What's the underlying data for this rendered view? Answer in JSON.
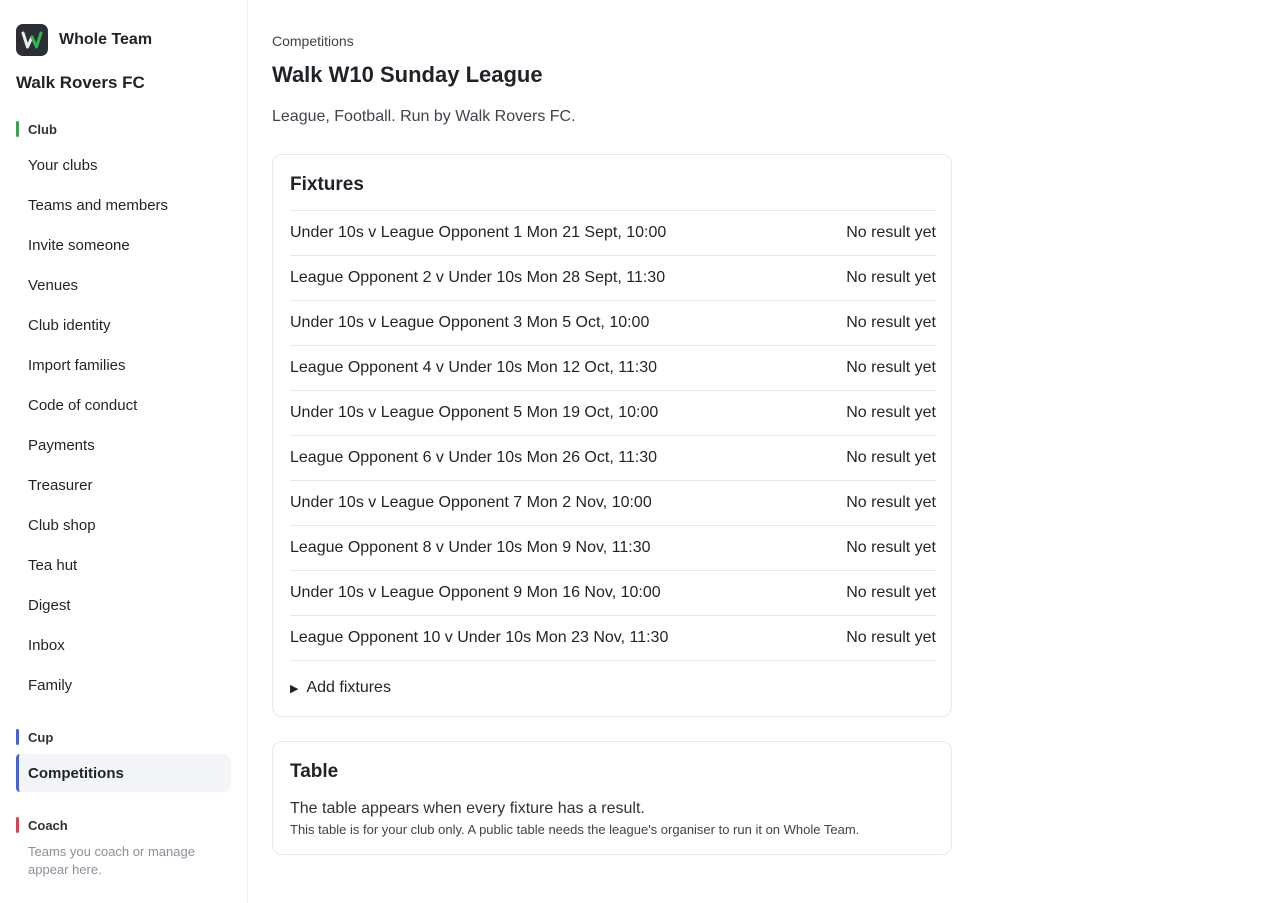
{
  "brand": {
    "name": "Whole Team",
    "logo_icon": "whole-team-w-logo",
    "logo_bg": "#2b2f33"
  },
  "sidebar": {
    "club_name": "Walk Rovers FC",
    "sections": {
      "club": {
        "label": "Club",
        "color": "#2fa84f"
      },
      "cup": {
        "label": "Cup",
        "color": "#3f63e0"
      },
      "coach": {
        "label": "Coach",
        "color": "#e0404a"
      }
    },
    "club_items": [
      "Your clubs",
      "Teams and members",
      "Invite someone",
      "Venues",
      "Club identity",
      "Import families",
      "Code of conduct",
      "Payments",
      "Treasurer",
      "Club shop",
      "Tea hut",
      "Digest",
      "Inbox",
      "Family"
    ],
    "cup_items": [
      "Competitions"
    ],
    "coach_note": "Teams you coach or manage appear here."
  },
  "main": {
    "breadcrumb": "Competitions",
    "title": "Walk W10 Sunday League",
    "subtitle": "League, Football. Run by Walk Rovers FC.",
    "fixtures": {
      "heading": "Fixtures",
      "rows": [
        {
          "match": "Under 10s v League Opponent 1 Mon 21 Sept, 10:00",
          "status": "No result yet"
        },
        {
          "match": "League Opponent 2 v Under 10s Mon 28 Sept, 11:30",
          "status": "No result yet"
        },
        {
          "match": "Under 10s v League Opponent 3 Mon 5 Oct, 10:00",
          "status": "No result yet"
        },
        {
          "match": "League Opponent 4 v Under 10s Mon 12 Oct, 11:30",
          "status": "No result yet"
        },
        {
          "match": "Under 10s v League Opponent 5 Mon 19 Oct, 10:00",
          "status": "No result yet"
        },
        {
          "match": "League Opponent 6 v Under 10s Mon 26 Oct, 11:30",
          "status": "No result yet"
        },
        {
          "match": "Under 10s v League Opponent 7 Mon 2 Nov, 10:00",
          "status": "No result yet"
        },
        {
          "match": "League Opponent 8 v Under 10s Mon 9 Nov, 11:30",
          "status": "No result yet"
        },
        {
          "match": "Under 10s v League Opponent 9 Mon 16 Nov, 10:00",
          "status": "No result yet"
        },
        {
          "match": "League Opponent 10 v Under 10s Mon 23 Nov, 11:30",
          "status": "No result yet"
        }
      ],
      "add_label": "Add fixtures"
    },
    "table": {
      "heading": "Table",
      "message": "The table appears when every fixture has a result.",
      "note": "This table is for your club only. A public table needs the league's organiser to run it on Whole Team."
    }
  }
}
